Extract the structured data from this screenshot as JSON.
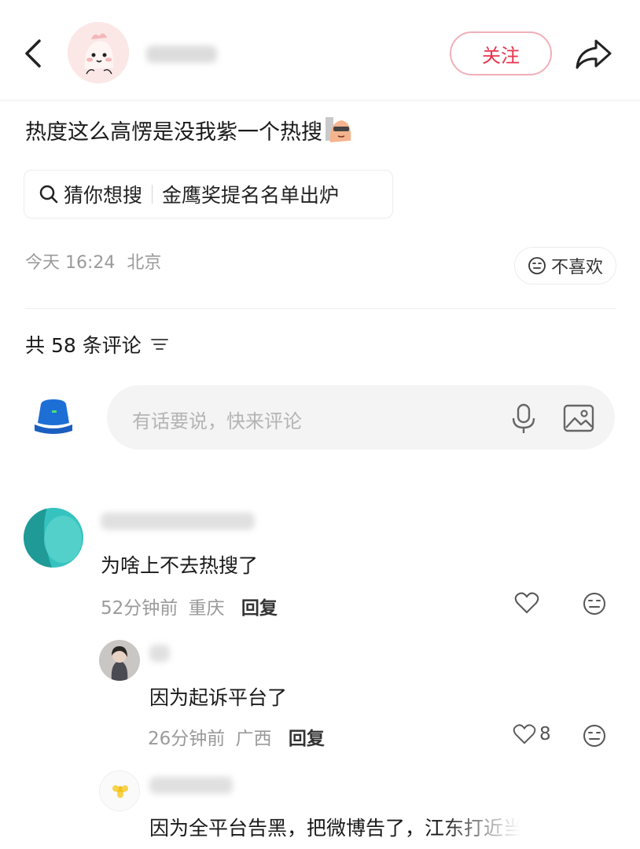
{
  "header": {
    "follow_label": "关注"
  },
  "post": {
    "text": "热度这么高愣是没我紫一个热搜",
    "guess_label": "猜你想搜",
    "guess_query": "金鹰奖提名名单出炉",
    "time": "今天 16:24",
    "location": "北京",
    "dislike_label": "不喜欢"
  },
  "comments_header": {
    "label": "共 58 条评论"
  },
  "composer": {
    "placeholder": "有话要说，快来评论"
  },
  "comments": [
    {
      "text": "为啥上不去热搜了",
      "time": "52分钟前",
      "location": "重庆",
      "reply_label": "回复",
      "likes": ""
    },
    {
      "text": "因为起诉平台了",
      "time": "26分钟前",
      "location": "广西",
      "reply_label": "回复",
      "likes": "8"
    },
    {
      "text": "因为全平台告黑，把微博告了，江东打近当中"
    }
  ],
  "colors": {
    "accent": "#e8334c",
    "follow_border": "#f0b0b8",
    "meta": "#9a9a9a"
  }
}
